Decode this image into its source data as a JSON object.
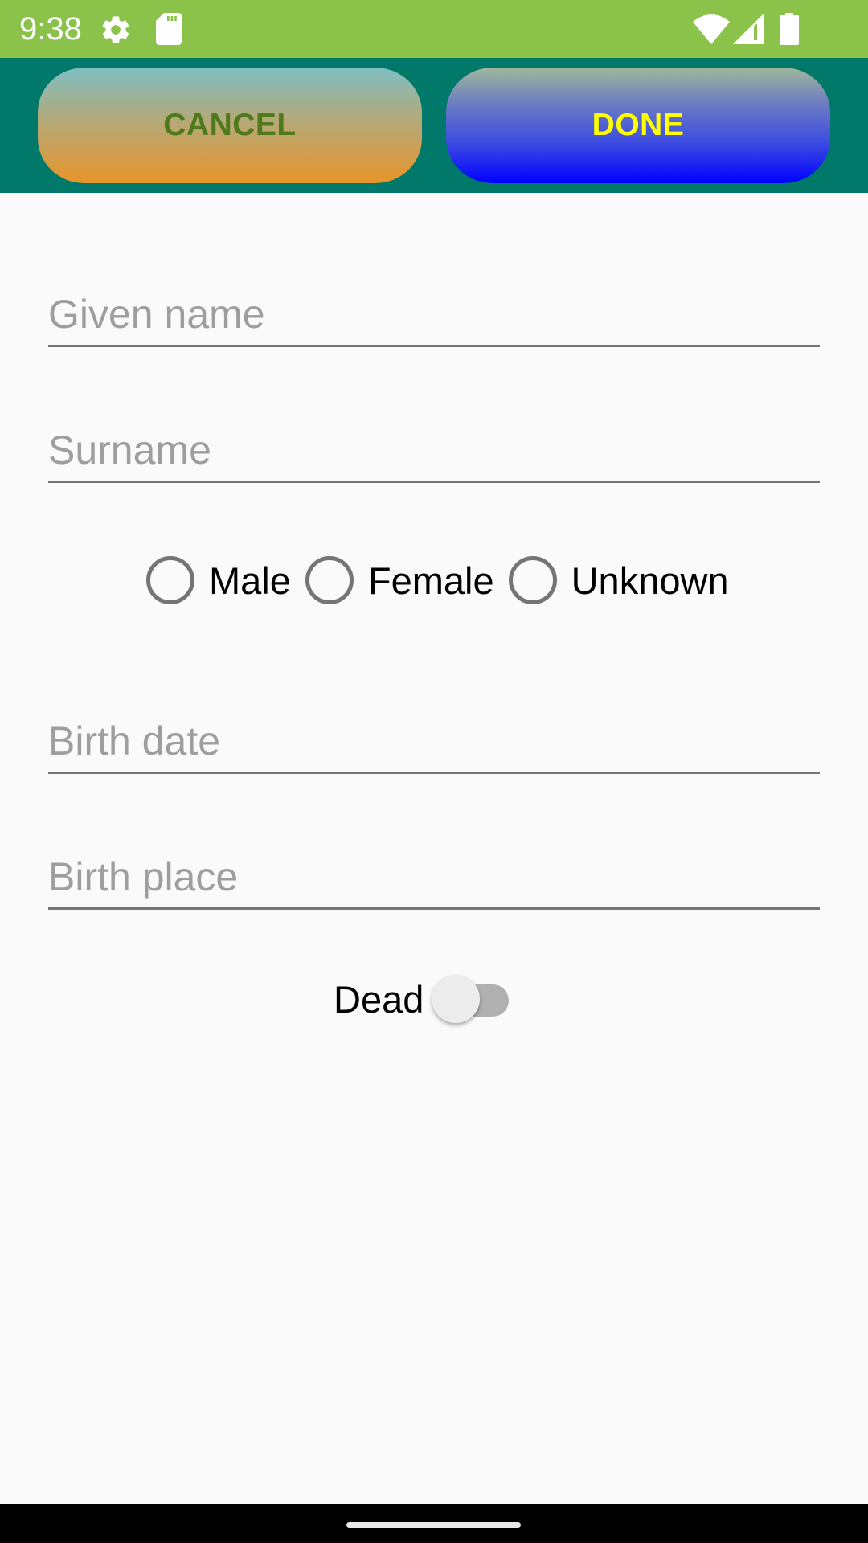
{
  "status_bar": {
    "time": "9:38",
    "left_icons": [
      "gear-icon",
      "sd-card-icon"
    ],
    "right_icons": [
      "wifi-icon",
      "cell-signal-icon",
      "battery-icon"
    ]
  },
  "toolbar": {
    "cancel_label": "CANCEL",
    "done_label": "DONE"
  },
  "form": {
    "given_name": {
      "value": "",
      "placeholder": "Given name"
    },
    "surname": {
      "value": "",
      "placeholder": "Surname"
    },
    "gender": {
      "options": [
        {
          "label": "Male",
          "selected": false
        },
        {
          "label": "Female",
          "selected": false
        },
        {
          "label": "Unknown",
          "selected": false
        }
      ]
    },
    "birth_date": {
      "value": "",
      "placeholder": "Birth date"
    },
    "birth_place": {
      "value": "",
      "placeholder": "Birth place"
    },
    "dead": {
      "label": "Dead",
      "checked": false
    }
  },
  "colors": {
    "status_bar": "#8bc34a",
    "toolbar": "#00796b",
    "cancel_text": "#4e7a1a",
    "done_text": "#ffff00",
    "background": "#fafafa"
  }
}
